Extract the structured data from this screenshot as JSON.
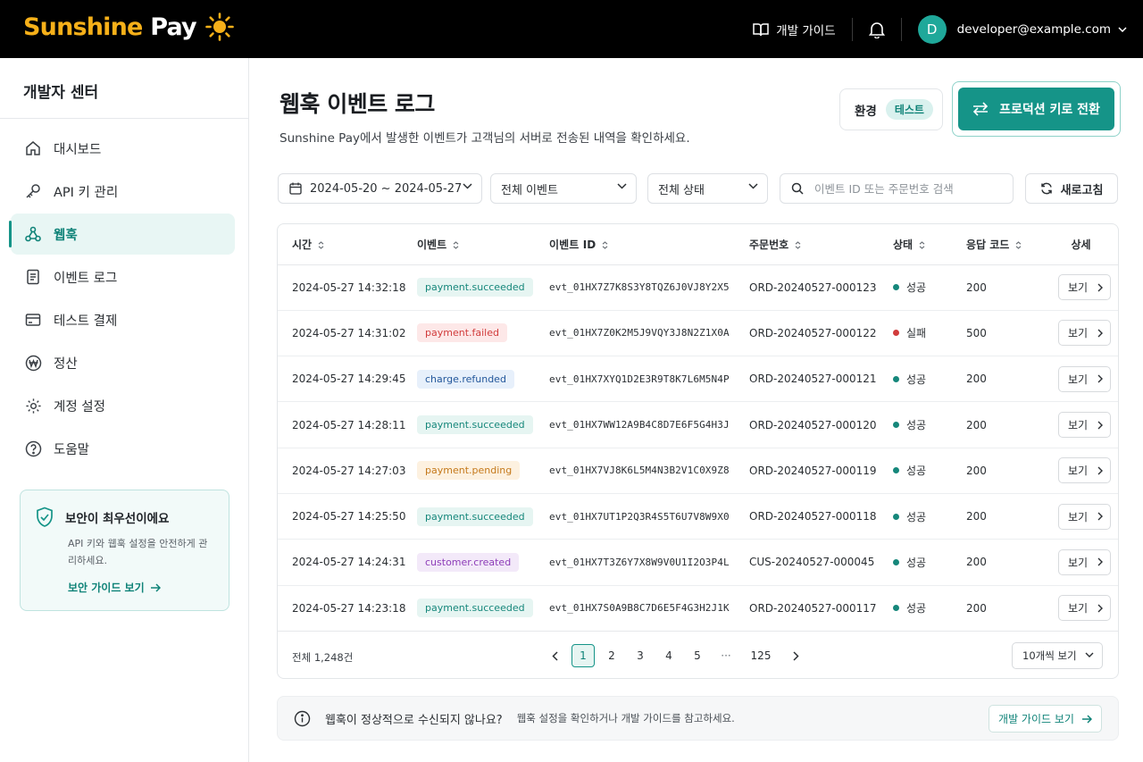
{
  "brand": {
    "name_part1": "Sunshine",
    "name_part2": "Pay",
    "sun_color": "#f6b019"
  },
  "topbar": {
    "guide_label": "개발 가이드",
    "avatar_initial": "D",
    "user_email": "developer@example.com"
  },
  "sidebar": {
    "title": "개발자 센터",
    "items": [
      {
        "label": "대시보드",
        "icon": "home-icon"
      },
      {
        "label": "API 키 관리",
        "icon": "key-icon"
      },
      {
        "label": "웹훅",
        "icon": "webhook-icon",
        "active": true
      },
      {
        "label": "이벤트 로그",
        "icon": "document-icon"
      },
      {
        "label": "테스트 결제",
        "icon": "card-icon"
      },
      {
        "label": "정산",
        "icon": "won-icon"
      },
      {
        "label": "계정 설정",
        "icon": "gear-icon"
      },
      {
        "label": "도움말",
        "icon": "help-icon"
      }
    ],
    "security_card": {
      "title": "보안이 최우선이에요",
      "desc": "API 키와 웹훅 설정을 안전하게 관리하세요.",
      "link": "보안 가이드 보기"
    }
  },
  "header": {
    "title": "웹훅 이벤트 로그",
    "subtitle": "Sunshine Pay에서 발생한 이벤트가 고객님의 서버로 전송된 내역을 확인하세요.",
    "env_label": "환경",
    "env_value": "테스트",
    "switch_label": "프로덕션 키로 전환"
  },
  "filters": {
    "date_range": "2024-05-20 ~ 2024-05-27",
    "event": "전체 이벤트",
    "status": "전체 상태",
    "search_placeholder": "이벤트 ID 또는 주문번호 검색",
    "refresh": "새로고침"
  },
  "table": {
    "columns": [
      "시간",
      "이벤트",
      "이벤트 ID",
      "주문번호",
      "상태",
      "응답 코드",
      "상세"
    ],
    "view_label": "보기",
    "rows": [
      {
        "time": "2024-05-27 14:32:18",
        "event": "payment.succeeded",
        "event_color": "green",
        "id": "evt_01HX7Z7K8S3Y8TQZ6J0VJ8Y2X5",
        "order": "ORD-20240527-000123",
        "status": "성공",
        "status_color": "#16877b",
        "code": "200"
      },
      {
        "time": "2024-05-27 14:31:02",
        "event": "payment.failed",
        "event_color": "red",
        "id": "evt_01HX7Z0K2M5J9VQY3J8N2Z1X0A",
        "order": "ORD-20240527-000122",
        "status": "실패",
        "status_color": "#d13c3c",
        "code": "500"
      },
      {
        "time": "2024-05-27 14:29:45",
        "event": "charge.refunded",
        "event_color": "blue",
        "id": "evt_01HX7XYQ1D2E3R9T8K7L6M5N4P",
        "order": "ORD-20240527-000121",
        "status": "성공",
        "status_color": "#16877b",
        "code": "200"
      },
      {
        "time": "2024-05-27 14:28:11",
        "event": "payment.succeeded",
        "event_color": "green",
        "id": "evt_01HX7WW12A9B4C8D7E6F5G4H3J",
        "order": "ORD-20240527-000120",
        "status": "성공",
        "status_color": "#16877b",
        "code": "200"
      },
      {
        "time": "2024-05-27 14:27:03",
        "event": "payment.pending",
        "event_color": "orange",
        "id": "evt_01HX7VJ8K6L5M4N3B2V1C0X9Z8",
        "order": "ORD-20240527-000119",
        "status": "성공",
        "status_color": "#16877b",
        "code": "200"
      },
      {
        "time": "2024-05-27 14:25:50",
        "event": "payment.succeeded",
        "event_color": "green",
        "id": "evt_01HX7UT1P2Q3R4S5T6U7V8W9X0",
        "order": "ORD-20240527-000118",
        "status": "성공",
        "status_color": "#16877b",
        "code": "200"
      },
      {
        "time": "2024-05-27 14:24:31",
        "event": "customer.created",
        "event_color": "purple",
        "id": "evt_01HX7T3Z6Y7X8W9V0U1I2O3P4L",
        "order": "CUS-20240527-000045",
        "status": "성공",
        "status_color": "#16877b",
        "code": "200"
      },
      {
        "time": "2024-05-27 14:23:18",
        "event": "payment.succeeded",
        "event_color": "green",
        "id": "evt_01HX7S0A9B8C7D6E5F4G3H2J1K",
        "order": "ORD-20240527-000117",
        "status": "성공",
        "status_color": "#16877b",
        "code": "200"
      }
    ]
  },
  "pagination": {
    "total": "전체 1,248건",
    "pages": [
      "1",
      "2",
      "3",
      "4",
      "5",
      "···",
      "125"
    ],
    "current": "1",
    "per_page": "10개씩 보기"
  },
  "help": {
    "question": "웹훅이 정상적으로 수신되지 않나요?",
    "desc": "웹훅 설정을 확인하거나 개발 가이드를 참고하세요.",
    "button": "개발 가이드 보기"
  },
  "colors": {
    "accent": "#159488",
    "accent_dark": "#0f8378",
    "accent_light": "#e8f6f4"
  }
}
